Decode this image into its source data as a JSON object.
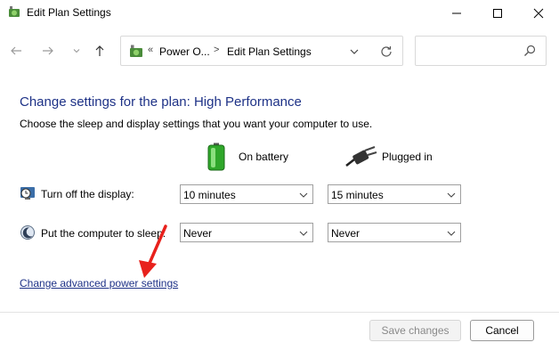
{
  "window": {
    "title": "Edit Plan Settings"
  },
  "address_bar": {
    "crumbs": [
      "Power O...",
      "Edit Plan Settings"
    ],
    "overflow": "«",
    "separator": ">"
  },
  "search": {
    "placeholder": ""
  },
  "main": {
    "heading": "Change settings for the plan: High Performance",
    "subtitle": "Choose the sleep and display settings that you want your computer to use.",
    "columns": {
      "battery": "On battery",
      "plugged": "Plugged in"
    },
    "rows": [
      {
        "label": "Turn off the display:",
        "battery": "10 minutes",
        "plugged": "15 minutes"
      },
      {
        "label": "Put the computer to sleep:",
        "battery": "Never",
        "plugged": "Never"
      }
    ],
    "advanced_link": "Change advanced power settings"
  },
  "footer": {
    "save": "Save changes",
    "cancel": "Cancel"
  },
  "colors": {
    "heading": "#1e3287",
    "link": "#1e3287",
    "annotation_arrow": "#e8211c"
  },
  "icons": [
    "power-options-icon",
    "back-arrow-icon",
    "forward-arrow-icon",
    "chevron-down-icon",
    "up-arrow-icon",
    "refresh-icon",
    "search-icon",
    "battery-icon",
    "plug-icon",
    "display-clock-icon",
    "sleep-moon-icon"
  ]
}
